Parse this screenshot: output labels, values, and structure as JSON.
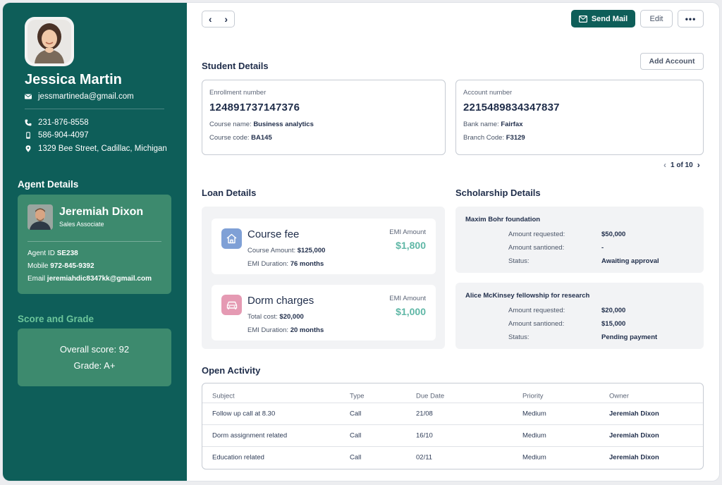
{
  "colors": {
    "sidebar": "#0e5e59",
    "card": "#3d8a6e",
    "accent_text": "#6cc59a",
    "emi": "#5fb7a6",
    "home_icon_bg": "#7fa0d6",
    "car_icon_bg": "#e59ab3"
  },
  "profile": {
    "name": "Jessica Martin",
    "email": "jessmartineda@gmail.com",
    "phone": "231-876-8558",
    "mobile": "586-904-4097",
    "address": "1329 Bee Street, Cadillac, Michigan"
  },
  "agent": {
    "section_title": "Agent Details",
    "name": "Jeremiah Dixon",
    "role": "Sales Associate",
    "id_label": "Agent ID",
    "id_value": "SE238",
    "mobile_label": "Mobile",
    "mobile_value": "972-845-9392",
    "email_label": "Email",
    "email_value": "jeremiahdic8347kk@gmail.com"
  },
  "score": {
    "section_title": "Score and Grade",
    "overall": "Overall score: 92",
    "grade": "Grade: A+"
  },
  "toolbar": {
    "prev_icon": "chevron-left-icon",
    "next_icon": "chevron-right-icon",
    "send_mail": "Send Mail",
    "edit": "Edit",
    "more": "•••"
  },
  "student": {
    "title": "Student Details",
    "add_account": "Add Account",
    "enrollment": {
      "label": "Enrollment number",
      "number": "124891737147376",
      "course_name_label": "Course name:",
      "course_name": "Business analytics",
      "course_code_label": "Course code:",
      "course_code": "BA145"
    },
    "account": {
      "label": "Account number",
      "number": "2215489834347837",
      "bank_label": "Bank name:",
      "bank": "Fairfax",
      "branch_label": "Branch Code:",
      "branch": "F3129"
    },
    "pager": "1 of 10"
  },
  "loan": {
    "title": "Loan Details",
    "items": [
      {
        "title": "Course fee",
        "amount_label": "Course Amount:",
        "amount": "$125,000",
        "duration_label": "EMI Duration:",
        "duration": "76 months",
        "emi_label": "EMI Amount",
        "emi": "$1,800",
        "icon": "home-icon"
      },
      {
        "title": "Dorm charges",
        "amount_label": "Total cost:",
        "amount": "$20,000",
        "duration_label": "EMI Duration:",
        "duration": "20 months",
        "emi_label": "EMI Amount",
        "emi": "$1,000",
        "icon": "car-icon"
      }
    ]
  },
  "scholarship": {
    "title": "Scholarship Details",
    "items": [
      {
        "name": "Maxim Bohr foundation",
        "requested_label": "Amount requested:",
        "requested": "$50,000",
        "sanctioned_label": "Amount santioned:",
        "sanctioned": "-",
        "status_label": "Status:",
        "status": "Awaiting approval"
      },
      {
        "name": "Alice McKinsey fellowship for research",
        "requested_label": "Amount requested:",
        "requested": "$20,000",
        "sanctioned_label": "Amount santioned:",
        "sanctioned": "$15,000",
        "status_label": "Status:",
        "status": "Pending payment"
      }
    ]
  },
  "activity": {
    "title": "Open Activity",
    "columns": [
      "Subject",
      "Type",
      "Due Date",
      "Priority",
      "Owner"
    ],
    "rows": [
      [
        "Follow up call at 8.30",
        "Call",
        "21/08",
        "Medium",
        "Jeremiah Dixon"
      ],
      [
        "Dorm assignment related",
        "Call",
        "16/10",
        "Medium",
        "Jeremiah Dixon"
      ],
      [
        "Education related",
        "Call",
        "02/11",
        "Medium",
        "Jeremiah Dixon"
      ]
    ]
  }
}
